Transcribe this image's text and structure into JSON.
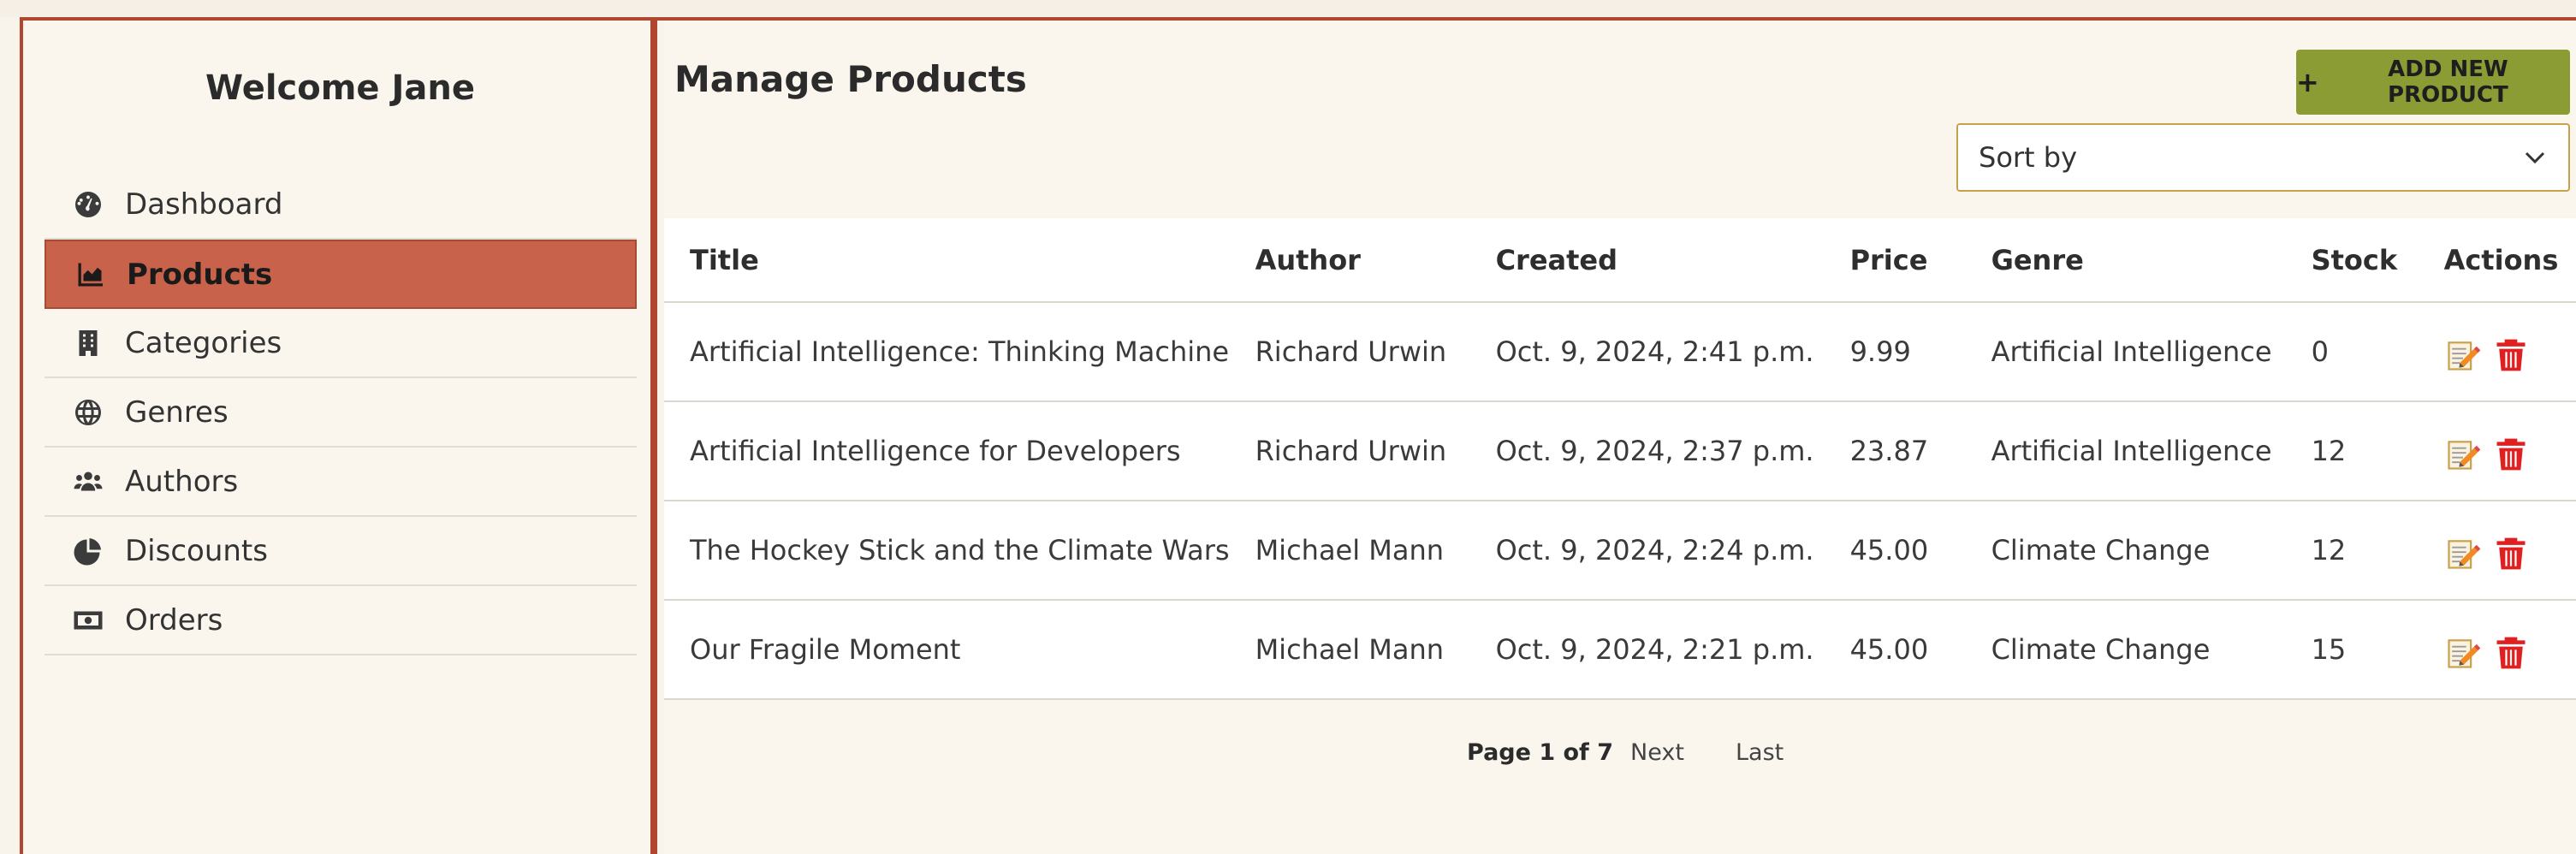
{
  "sidebar": {
    "welcome": "Welcome Jane",
    "items": [
      {
        "label": "Dashboard",
        "icon": "dashboard-icon"
      },
      {
        "label": "Products",
        "icon": "chart-area-icon",
        "active": true
      },
      {
        "label": "Categories",
        "icon": "building-icon"
      },
      {
        "label": "Genres",
        "icon": "globe-icon"
      },
      {
        "label": "Authors",
        "icon": "users-icon"
      },
      {
        "label": "Discounts",
        "icon": "pie-chart-icon"
      },
      {
        "label": "Orders",
        "icon": "money-bill-icon"
      }
    ]
  },
  "main": {
    "title": "Manage Products",
    "add_button": "ADD NEW PRODUCT",
    "sort": {
      "value": "Sort by"
    },
    "table": {
      "headers": [
        "Title",
        "Author",
        "Created",
        "Price",
        "Genre",
        "Stock",
        "Actions"
      ],
      "rows": [
        {
          "title": "Artificial Intelligence: Thinking Machine",
          "author": "Richard Urwin",
          "created": "Oct. 9, 2024, 2:41 p.m.",
          "price": "9.99",
          "genre": "Artificial Intelligence",
          "stock": "0"
        },
        {
          "title": "Artificial Intelligence for Developers",
          "author": "Richard Urwin",
          "created": "Oct. 9, 2024, 2:37 p.m.",
          "price": "23.87",
          "genre": "Artificial Intelligence",
          "stock": "12"
        },
        {
          "title": "The Hockey Stick and the Climate Wars",
          "author": "Michael Mann",
          "created": "Oct. 9, 2024, 2:24 p.m.",
          "price": "45.00",
          "genre": "Climate Change",
          "stock": "12"
        },
        {
          "title": "Our Fragile Moment",
          "author": "Michael Mann",
          "created": "Oct. 9, 2024, 2:21 p.m.",
          "price": "45.00",
          "genre": "Climate Change",
          "stock": "15"
        }
      ]
    },
    "pagination": {
      "current": "Page 1 of 7",
      "next": "Next",
      "last": "Last"
    }
  },
  "colors": {
    "accent": "#b04530",
    "active_nav": "#c9624a",
    "add_button": "#8c9c35",
    "delete": "#e02020"
  }
}
